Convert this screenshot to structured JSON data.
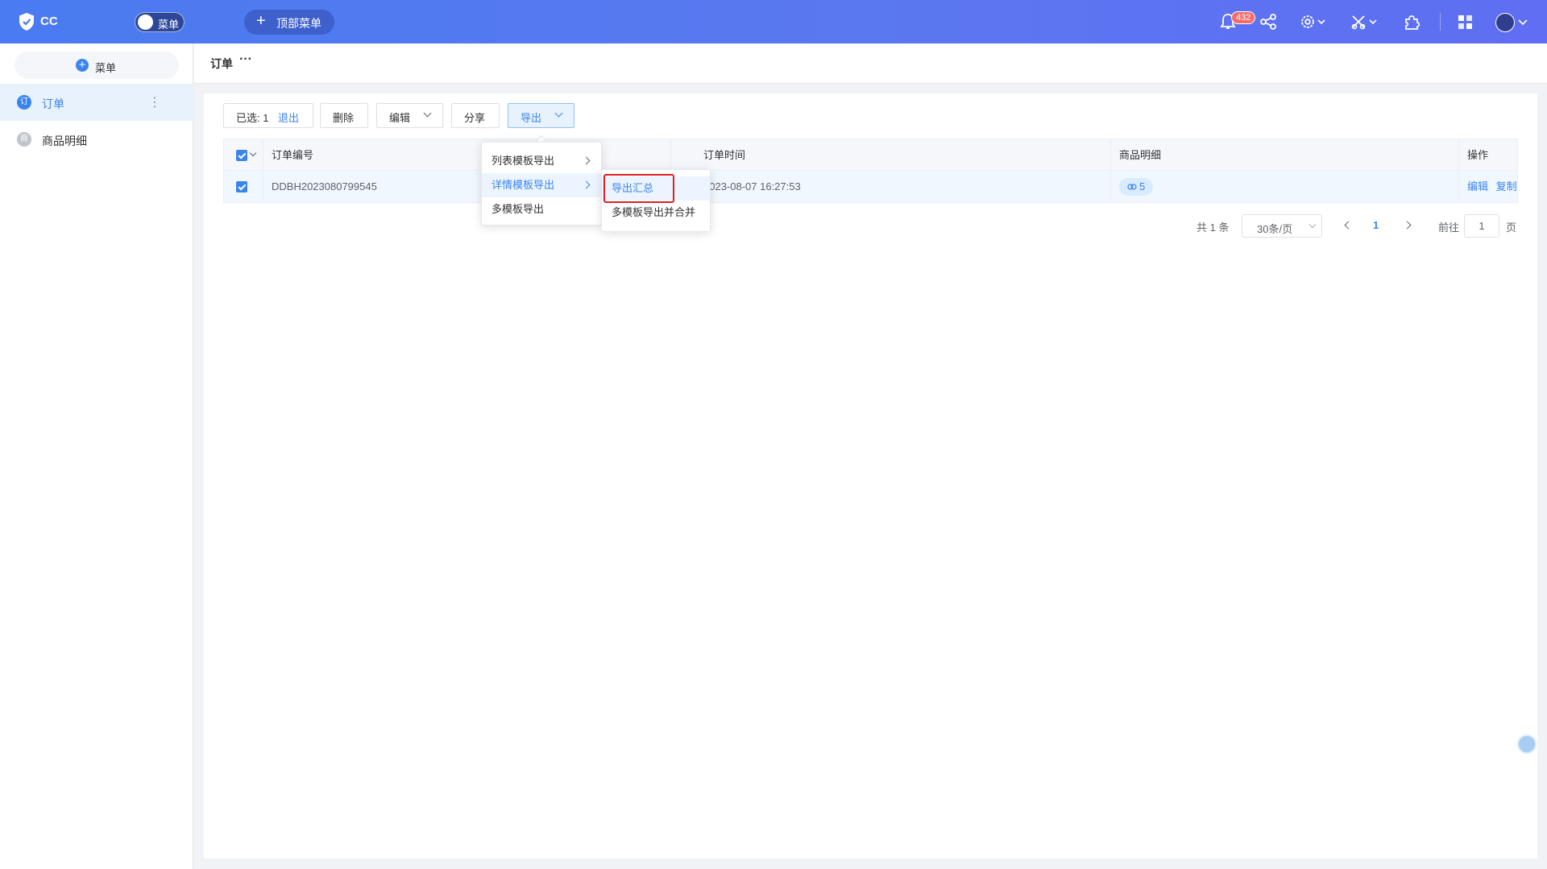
{
  "app": {
    "name": "CC",
    "menu_toggle_label": "菜单",
    "top_menu_label": "顶部菜单"
  },
  "topbar": {
    "notification_count": "432"
  },
  "sidebar": {
    "add_menu_label": "菜单",
    "items": [
      {
        "icon_text": "订",
        "label": "订单",
        "active": true
      },
      {
        "icon_text": "商",
        "label": "商品明细",
        "active": false
      }
    ]
  },
  "breadcrumb": {
    "title": "订单",
    "more": "···"
  },
  "toolbar": {
    "selected_label": "已选: 1",
    "exit_label": "退出",
    "delete_label": "删除",
    "edit_label": "编辑",
    "share_label": "分享",
    "export_label": "导出"
  },
  "table": {
    "columns": [
      "订单编号",
      "订单时间",
      "商品明细",
      "操作"
    ],
    "rows": [
      {
        "order_no": "DDBH2023080799545",
        "order_time": "2023-08-07 16:27:53",
        "detail_count": "5",
        "actions": [
          "编辑",
          "复制"
        ]
      }
    ]
  },
  "pagination": {
    "total_label": "共 1 条",
    "page_size": "30条/页",
    "current_page": "1",
    "goto_label": "前往",
    "goto_value": "1",
    "page_unit": "页"
  },
  "export_menu": {
    "items": [
      "列表模板导出",
      "详情模板导出",
      "多模板导出"
    ],
    "submenu": [
      "导出汇总",
      "多模板导出并合并"
    ]
  },
  "colors": {
    "accent": "#3a84f0",
    "topbar": "#4a7bf0",
    "highlight": "#e02020"
  }
}
